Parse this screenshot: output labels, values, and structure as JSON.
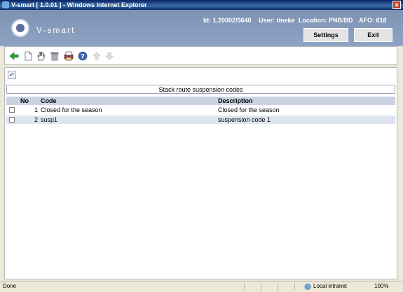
{
  "window": {
    "title": "V-smart [ 1.0.01 ] - Windows Internet Explorer",
    "close_glyph": "✕"
  },
  "header": {
    "brand": "V-smart",
    "id": "Id: 1.20002/5640",
    "user": "User: tineke",
    "location": "Location: PNB/BD",
    "afo": "AFO: 618",
    "settings_label": "Settings",
    "exit_label": "Exit"
  },
  "toolbar": {
    "icons": [
      "back-icon",
      "new-document-icon",
      "select-hand-icon",
      "delete-icon",
      "print-icon",
      "help-icon",
      "move-up-icon",
      "move-down-icon"
    ]
  },
  "content": {
    "undo_glyph": "↶",
    "title": "Stack route suspension codes",
    "columns": {
      "no": "No",
      "code": "Code",
      "description": "Description"
    },
    "rows": [
      {
        "no": "1",
        "code": "Closed for the season",
        "description": "Closed for the season"
      },
      {
        "no": "2",
        "code": "susp1",
        "description": "suspension code 1"
      }
    ]
  },
  "status": {
    "left": "Done",
    "zone": "Local intranet",
    "zoom": "100%"
  },
  "colors": {
    "header": "#7D92B3",
    "table_header": "#C9D3E4",
    "row_alt": "#DEE5F1"
  }
}
